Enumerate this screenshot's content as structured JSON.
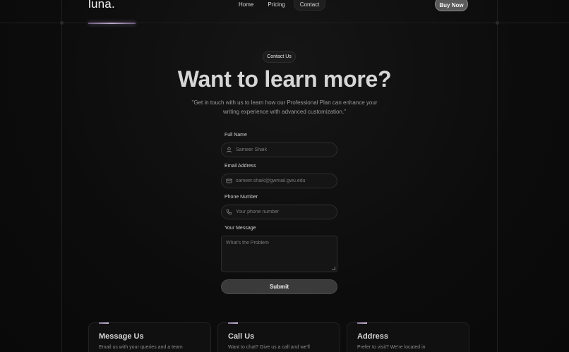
{
  "nav": {
    "logo": "luna.",
    "links": [
      "Home",
      "Pricing",
      "Contact"
    ],
    "active": "Contact",
    "buy_label": "Buy Now"
  },
  "hero": {
    "badge": "Contact Us",
    "title": "Want to learn more?",
    "subtitle": "\"Get in touch with us to learn how our Professional Plan can enhance your writing experience with advanced customization.\""
  },
  "form": {
    "name_label": "Full Name",
    "name_placeholder": "Sameer Shaik",
    "email_label": "Email Address",
    "email_placeholder": "sameer.shaik@gwmail.gwu.edu",
    "phone_label": "Phone Number",
    "phone_placeholder": "Your phone number",
    "message_label": "Your Message",
    "message_placeholder": "What's the Problem",
    "submit_label": "Submit"
  },
  "cards": [
    {
      "title": "Message Us",
      "text": "Email us with your queries and a team"
    },
    {
      "title": "Call Us",
      "text": "Want to chat? Give us a call and we'll"
    },
    {
      "title": "Address",
      "text": "Prefer to visit? We're located in"
    }
  ],
  "icons": {
    "name": "user-icon",
    "email": "mail-icon",
    "phone": "phone-icon"
  },
  "colors": {
    "background": "#0c0c0c",
    "accent": "#b8a8c8"
  }
}
